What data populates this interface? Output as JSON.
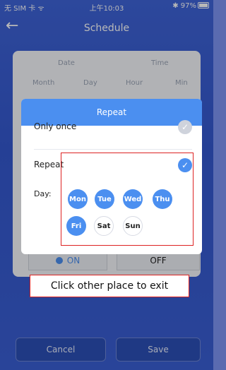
{
  "status_bar": {
    "carrier": "无 SIM 卡 ᯤ",
    "time": "上午10:03",
    "battery": "✱ 97%"
  },
  "header": {
    "back_icon": "arrow-left-icon",
    "title": "Schedule"
  },
  "schedule_panel": {
    "date_label": "Date",
    "time_label": "Time",
    "month_label": "Month",
    "day_label": "Day",
    "hour_label": "Hour",
    "min_label": "Min"
  },
  "repeat_modal": {
    "title": "Repeat",
    "only_once_label": "Only once",
    "repeat_label": "Repeat",
    "day_label": "Day:",
    "days": [
      {
        "label": "Mon",
        "selected": true
      },
      {
        "label": "Tue",
        "selected": true
      },
      {
        "label": "Wed",
        "selected": true
      },
      {
        "label": "Thu",
        "selected": true
      },
      {
        "label": "Fri",
        "selected": true
      },
      {
        "label": "Sat",
        "selected": false
      },
      {
        "label": "Sun",
        "selected": false
      }
    ]
  },
  "toggle": {
    "on_label": "ON",
    "off_label": "OFF"
  },
  "hint": {
    "text": "Click other place to exit"
  },
  "footer": {
    "cancel_label": "Cancel",
    "save_label": "Save"
  },
  "colors": {
    "accent": "#4b8ff0",
    "background": "#3458cf",
    "annotation": "#dd2222"
  }
}
